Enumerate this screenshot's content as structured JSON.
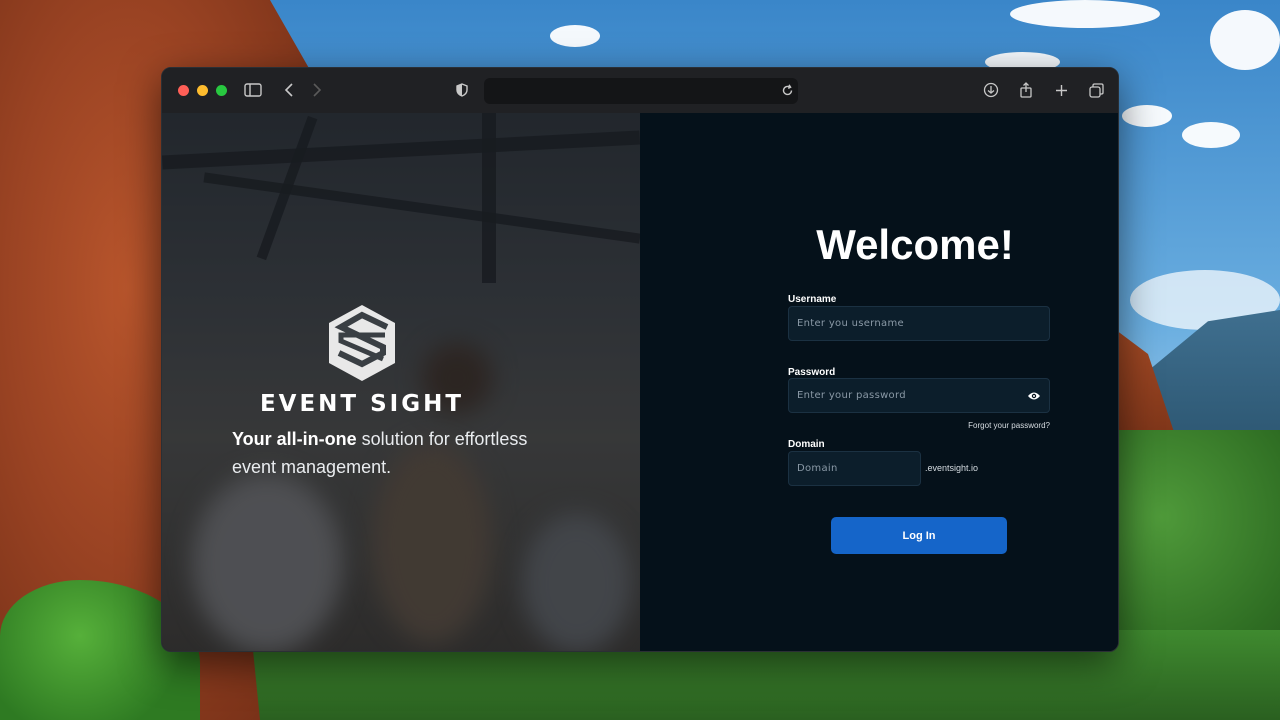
{
  "browser": {
    "address_text": "",
    "icons": [
      "sidebar-icon",
      "back-icon",
      "forward-icon",
      "privacy-shield-icon",
      "reload-icon",
      "download-icon",
      "share-icon",
      "new-tab-icon",
      "tab-overview-icon"
    ]
  },
  "hero": {
    "brand_name": "EVENT SIGHT",
    "tagline_bold": "Your all-in-one",
    "tagline_rest": " solution for effortless event management."
  },
  "login": {
    "title": "Welcome!",
    "username_label": "Username",
    "username_placeholder": "Enter you username",
    "password_label": "Password",
    "password_placeholder": "Enter your password",
    "forgot_password": "Forgot your password?",
    "domain_label": "Domain",
    "domain_placeholder": "Domain",
    "domain_suffix": ".eventsight.io",
    "login_button": "Log In"
  },
  "colors": {
    "panel_bg": "#05111a",
    "input_bg": "#0c1e2b",
    "accent": "#1565c9"
  }
}
